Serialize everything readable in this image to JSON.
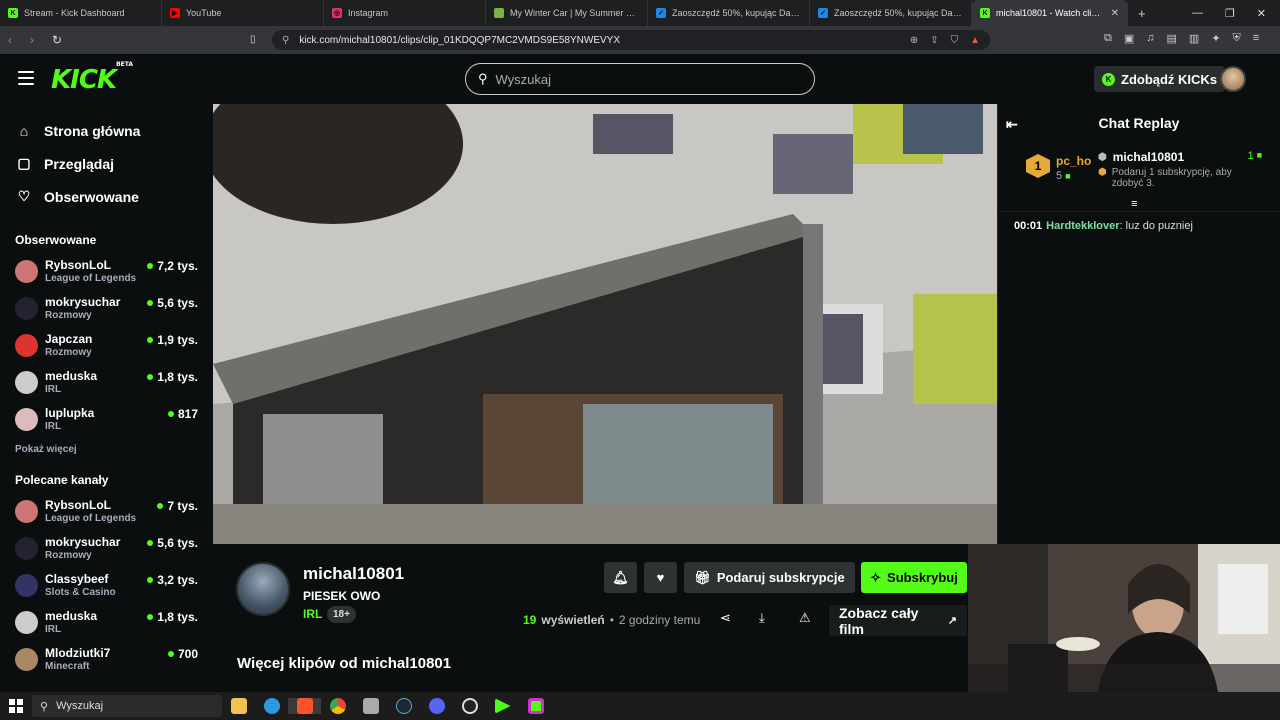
{
  "browser": {
    "tabs": [
      {
        "title": "Stream - Kick Dashboard",
        "fav": "K",
        "color": "#53fc18"
      },
      {
        "title": "YouTube",
        "fav": "▶",
        "color": "#ff0000"
      },
      {
        "title": "Instagram",
        "fav": "◎",
        "color": "#e1306c"
      },
      {
        "title": "My Winter Car | My Summer Car Wi…",
        "fav": "",
        "color": "#7bb342"
      },
      {
        "title": "Zaoszczędź 50%, kupując Darts and…",
        "fav": "✓",
        "color": "#1e88e5"
      },
      {
        "title": "Zaoszczędź 50%, kupując Darts Up o…",
        "fav": "✓",
        "color": "#1e88e5"
      },
      {
        "title": "michal10801 - Watch clips o…",
        "fav": "K",
        "color": "#53fc18"
      }
    ],
    "url": "kick.com/michal10801/clips/clip_01KDQQP7MC2VMDS9E58YNWEVYX"
  },
  "header": {
    "logo": "KICK",
    "logo_badge": "BETA",
    "search_placeholder": "Wyszukaj",
    "kicks_label": "Zdobądź KICKs"
  },
  "sidebar": {
    "nav": [
      {
        "label": "Strona główna",
        "icon": "home-icon",
        "glyph": "⌂"
      },
      {
        "label": "Przeglądaj",
        "icon": "browse-icon",
        "glyph": "▢"
      },
      {
        "label": "Obserwowane",
        "icon": "heart-icon",
        "glyph": "♡"
      }
    ],
    "followed_title": "Obserwowane",
    "followed": [
      {
        "name": "RybsonLoL",
        "category": "League of Legends",
        "viewers": "7,2 tys.",
        "av": "#c77"
      },
      {
        "name": "mokrysuchar",
        "category": "Rozmowy",
        "viewers": "5,6 tys.",
        "av": "#223"
      },
      {
        "name": "Japczan",
        "category": "Rozmowy",
        "viewers": "1,9 tys.",
        "av": "#d33"
      },
      {
        "name": "meduska",
        "category": "IRL",
        "viewers": "1,8 tys.",
        "av": "#ccc"
      },
      {
        "name": "luplupka",
        "category": "IRL",
        "viewers": "817",
        "av": "#dbb"
      }
    ],
    "show_more": "Pokaż więcej",
    "recommended_title": "Polecane kanały",
    "recommended": [
      {
        "name": "RybsonLoL",
        "category": "League of Legends",
        "viewers": "7 tys.",
        "av": "#c77"
      },
      {
        "name": "mokrysuchar",
        "category": "Rozmowy",
        "viewers": "5,6 tys.",
        "av": "#223"
      },
      {
        "name": "Classybeef",
        "category": "Slots & Casino",
        "viewers": "3,2 tys.",
        "av": "#336"
      },
      {
        "name": "meduska",
        "category": "IRL",
        "viewers": "1,8 tys.",
        "av": "#ccc"
      },
      {
        "name": "Mlodziutki7",
        "category": "Minecraft",
        "viewers": "700",
        "av": "#a86"
      }
    ]
  },
  "clip": {
    "channel": "michal10801",
    "title": "PIESEK OWO",
    "category": "IRL",
    "age_badge": "18+",
    "gift_label": "Podaruj subskrypcje",
    "subscribe_label": "Subskrybuj",
    "views": "19",
    "views_label": "wyświetleń",
    "time": "2 godziny temu",
    "watch_full": "Zobacz cały film",
    "more_clips": "Więcej klipów od michal10801"
  },
  "chat": {
    "title": "Chat Replay",
    "pinned": {
      "rank": "1",
      "top_user": "pc_ho",
      "top_count": "5",
      "gifter": "michal10801",
      "gifter_count": "1",
      "goal_text": "Podaruj 1 subskrypcję, aby zdobyć 3."
    },
    "messages": [
      {
        "time": "00:01",
        "user": "Hardtekklover",
        "text": "luz do puzniej"
      }
    ]
  },
  "taskbar": {
    "search_placeholder": "Wyszukaj"
  }
}
